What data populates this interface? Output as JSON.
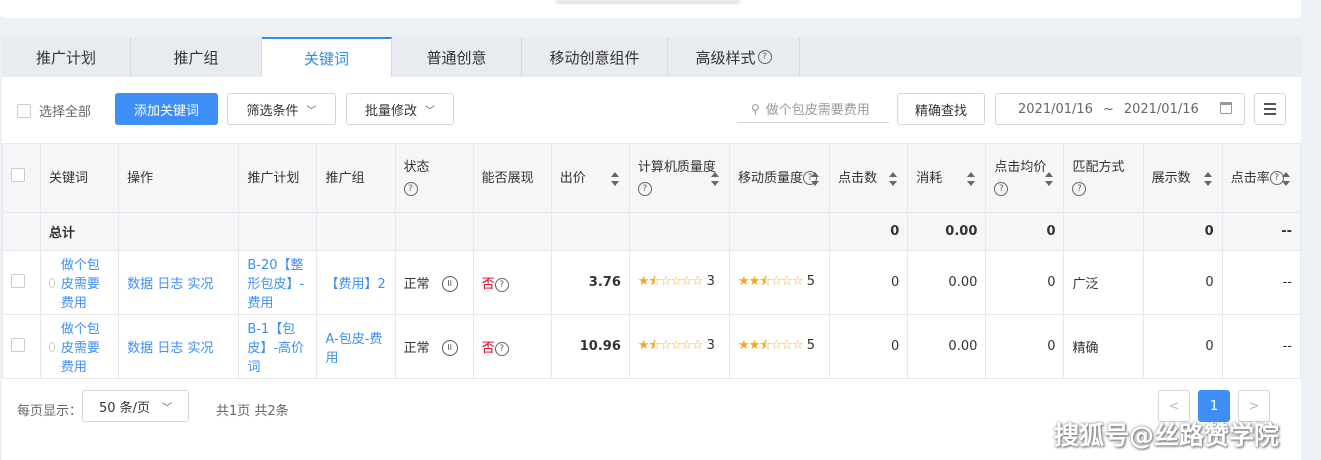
{
  "tabs": [
    "推广计划",
    "推广组",
    "关键词",
    "普通创意",
    "移动创意组件",
    "高级样式"
  ],
  "toolbar": {
    "select_all": "选择全部",
    "add_keyword": "添加关键词",
    "filter": "筛选条件",
    "batch_edit": "批量修改",
    "search_placeholder": "做个包皮需要费用",
    "exact_search": "精确查找",
    "date_from": "2021/01/16",
    "date_sep": "~",
    "date_to": "2021/01/16"
  },
  "columns": {
    "keyword": "关键词",
    "ops": "操作",
    "plan": "推广计划",
    "group": "推广组",
    "status": "状态",
    "show": "能否展现",
    "bid": "出价",
    "quality": "计算机质量度",
    "mquality": "移动质量度",
    "clicks": "点击数",
    "cost": "消耗",
    "cpc": "点击均价",
    "match": "匹配方式",
    "impr": "展示数",
    "ctr": "点击率"
  },
  "summary": {
    "label": "总计",
    "clicks": "0",
    "cost": "0.00",
    "cpc": "0",
    "impr": "0",
    "ctr": "--"
  },
  "rows": [
    {
      "keyword": "做个包皮需要费用",
      "op_data": "数据",
      "op_log": "日志",
      "op_live": "实况",
      "plan": "B-20【整形包皮】-费用",
      "group": "【费用】2",
      "status": "正常",
      "show": "否",
      "bid": "3.76",
      "quality": "3",
      "quality_stars": 1.5,
      "mquality": "5",
      "mquality_stars": 2.5,
      "clicks": "0",
      "cost": "0.00",
      "cpc": "0",
      "match": "广泛",
      "impr": "0",
      "ctr": "--"
    },
    {
      "keyword": "做个包皮需要费用",
      "op_data": "数据",
      "op_log": "日志",
      "op_live": "实况",
      "plan": "B-1【包皮】-高价词",
      "group": "A-包皮-费用",
      "status": "正常",
      "show": "否",
      "bid": "10.96",
      "quality": "3",
      "quality_stars": 1.5,
      "mquality": "5",
      "mquality_stars": 2.5,
      "clicks": "0",
      "cost": "0.00",
      "cpc": "0",
      "match": "精确",
      "impr": "0",
      "ctr": "--"
    }
  ],
  "footer": {
    "per_page_label": "每页显示：",
    "per_page_value": "50 条/页",
    "total": "共1页 共2条",
    "prev": "<",
    "page": "1",
    "next": ">"
  },
  "watermark": "搜狐号@丝路赞学院",
  "colors": {
    "accent": "#3d8ff5",
    "star": "#f5a623",
    "no": "#d0021b"
  }
}
